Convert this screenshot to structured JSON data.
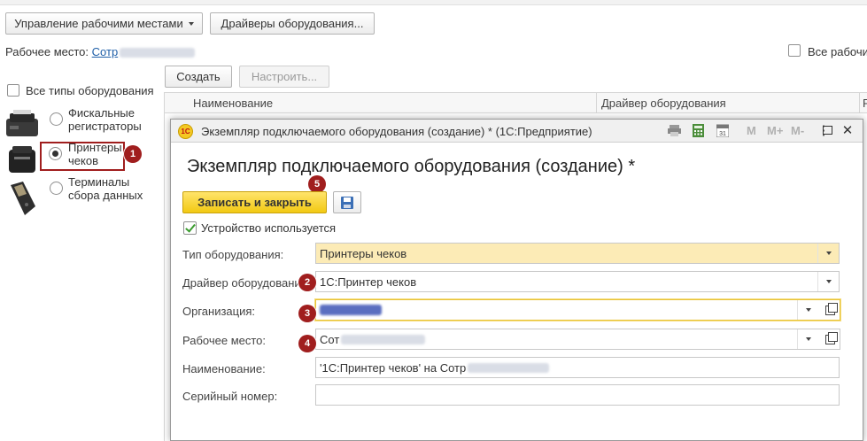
{
  "toolbar": {
    "workplaces_menu": "Управление рабочими местами",
    "drivers_button": "Драйверы оборудования..."
  },
  "workplace": {
    "label": "Рабочее место:",
    "link_text": "Сотр"
  },
  "all_workplaces_label": "Все рабочи",
  "all_types_label": "Все типы оборудования",
  "equipment_types": [
    {
      "label": "Фискальные регистраторы",
      "line1": "Фискальные",
      "line2": "регистраторы"
    },
    {
      "label": "Принтеры чеков",
      "line1": "Принтеры",
      "line2": "чеков"
    },
    {
      "label": "Терминалы сбора данных",
      "line1": "Терминалы",
      "line2": "сбора данных"
    }
  ],
  "list_toolbar": {
    "create": "Создать",
    "configure": "Настроить..."
  },
  "grid": {
    "columns": [
      "Наименование",
      "Драйвер оборудования",
      "Р"
    ]
  },
  "dialog": {
    "title": "Экземпляр подключаемого оборудования (создание) *  (1С:Предприятие)",
    "app_icon": "1С",
    "heading": "Экземпляр подключаемого оборудования (создание) *",
    "save_close": "Записать и закрыть",
    "device_used": "Устройство используется",
    "m_buttons": [
      "M",
      "M+",
      "M-"
    ],
    "fields": {
      "type_label": "Тип оборудования:",
      "type_value": "Принтеры чеков",
      "driver_label": "Драйвер оборудования:",
      "driver_value": "1С:Принтер чеков",
      "org_label": "Организация:",
      "workplace_label": "Рабочее место:",
      "workplace_value": "Сот",
      "name_label": "Наименование:",
      "name_value": "'1С:Принтер чеков' на Сотр",
      "serial_label": "Серийный номер:",
      "serial_value": ""
    }
  },
  "badges": [
    "1",
    "2",
    "3",
    "4",
    "5"
  ],
  "colors": {
    "badge": "#a01e1e",
    "save_close": "#f2c913",
    "link": "#1f5fa8",
    "required_field": "#fcebb6"
  }
}
